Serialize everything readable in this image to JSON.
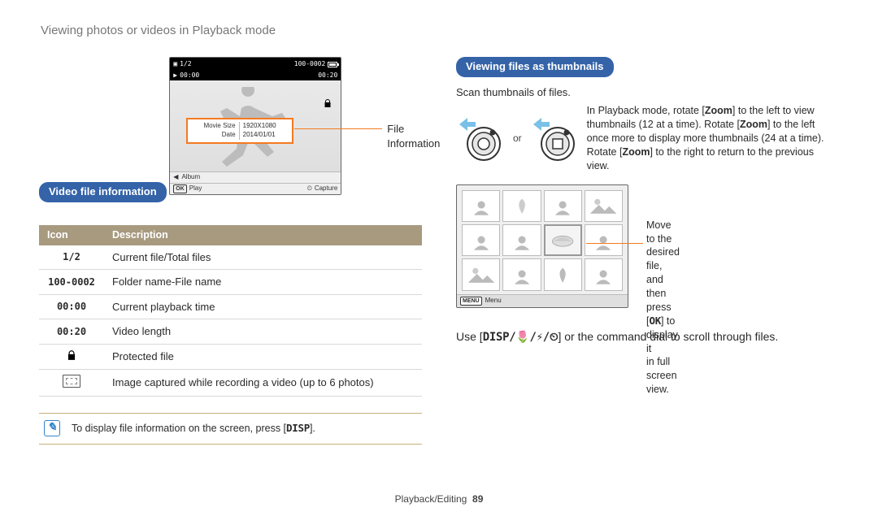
{
  "page": {
    "title": "Viewing photos or videos in Playback mode"
  },
  "left": {
    "heading": "Video file information",
    "lcd": {
      "counter": "1/2",
      "filecode": "100-0002",
      "play_time": "00:00",
      "video_len": "00:20",
      "info_title_size": "Movie Size",
      "info_val_size": "1920X1080",
      "info_title_date": "Date",
      "info_val_date": "2014/01/01",
      "album_label": "Album",
      "play_label": "Play",
      "capture_label": "Capture",
      "ok_badge": "OK",
      "timer_badge": "⏲"
    },
    "callout_label": "File Information",
    "table": {
      "head_icon": "Icon",
      "head_desc": "Description",
      "rows": [
        {
          "icon": "1/2",
          "desc": "Current file/Total files"
        },
        {
          "icon": "100-0002",
          "desc": "Folder name-File name"
        },
        {
          "icon": "00:00",
          "desc": "Current playback time"
        },
        {
          "icon": "00:20",
          "desc": "Video length"
        },
        {
          "icon": "key",
          "desc": "Protected file"
        },
        {
          "icon": "thumb",
          "desc": "Image captured while recording a video (up to 6 photos)"
        }
      ]
    },
    "note": {
      "text_prefix": "To display file information on the screen, press [",
      "key": "DISP",
      "text_suffix": "]."
    }
  },
  "right": {
    "heading": "Viewing files as thumbnails",
    "subtitle": "Scan thumbnails of files.",
    "or": "or",
    "zoom_text_1": "In Playback mode, rotate [",
    "zoom_bold_1": "Zoom",
    "zoom_text_2": "] to the left to view thumbnails (12 at a time). Rotate [",
    "zoom_bold_2": "Zoom",
    "zoom_text_3": "] to the left once more to display more thumbnails (24 at a time). Rotate [",
    "zoom_bold_3": "Zoom",
    "zoom_text_4": "] to the right to return to the previous view.",
    "callout_line1": "Move to the desired file, and",
    "callout_line2_pre": "then press [",
    "callout_key": "OK",
    "callout_line2_post": "] to display it",
    "callout_line3": "in full screen view.",
    "menu_badge": "MENU",
    "menu_label": "Menu",
    "instruction_pre": "Use [",
    "instruction_keys": "DISP/🌷/⚡/⏲",
    "instruction_post": "] or the command dial to scroll through files."
  },
  "footer": {
    "section": "Playback/Editing",
    "page_no": "89"
  }
}
